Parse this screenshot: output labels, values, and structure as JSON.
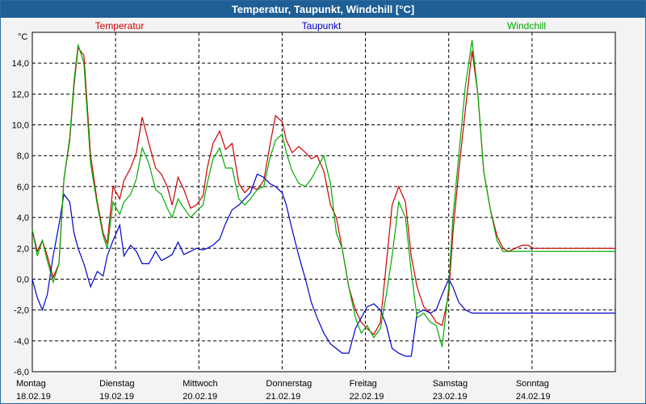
{
  "window": {
    "title": "Temperatur, Taupunkt, Windchill [°C]"
  },
  "colors": {
    "title_bg": "#1f5f96",
    "temperatur": "#cc0000",
    "taupunkt": "#0000cc",
    "windchill": "#00aa00",
    "grid": "#000000"
  },
  "chart_data": {
    "type": "line",
    "title": "Temperatur, Taupunkt, Windchill [°C]",
    "ylabel": "°C",
    "xlabel": "",
    "ylim": [
      -6.0,
      16.0
    ],
    "yticks": [
      "14,0",
      "12,0",
      "10,0",
      "8,0",
      "6,0",
      "4,0",
      "2,0",
      "0,0",
      "-2,0",
      "-4,0",
      "-6,0"
    ],
    "ytick_values": [
      14,
      12,
      10,
      8,
      6,
      4,
      2,
      0,
      -2,
      -4,
      -6
    ],
    "xlim": [
      0,
      7
    ],
    "grid": true,
    "legend_position": "top",
    "days": [
      {
        "name": "Montag",
        "date": "18.02.19"
      },
      {
        "name": "Dienstag",
        "date": "19.02.19"
      },
      {
        "name": "Mittwoch",
        "date": "20.02.19"
      },
      {
        "name": "Donnerstag",
        "date": "21.02.19"
      },
      {
        "name": "Freitag",
        "date": "22.02.19"
      },
      {
        "name": "Samstag",
        "date": "23.02.19"
      },
      {
        "name": "Sonntag",
        "date": "24.02.19"
      }
    ],
    "series": [
      {
        "name": "Temperatur",
        "color": "#cc0000",
        "x": [
          0,
          0.06,
          0.12,
          0.18,
          0.25,
          0.32,
          0.38,
          0.45,
          0.5,
          0.55,
          0.62,
          0.7,
          0.78,
          0.85,
          0.9,
          0.97,
          1.05,
          1.1,
          1.18,
          1.25,
          1.32,
          1.4,
          1.48,
          1.55,
          1.62,
          1.68,
          1.75,
          1.82,
          1.9,
          1.97,
          2.05,
          2.1,
          2.17,
          2.25,
          2.32,
          2.4,
          2.48,
          2.55,
          2.62,
          2.7,
          2.78,
          2.85,
          2.92,
          3.0,
          3.05,
          3.12,
          3.2,
          3.28,
          3.35,
          3.42,
          3.5,
          3.58,
          3.65,
          3.72,
          3.8,
          3.88,
          3.95,
          4.02,
          4.1,
          4.18,
          4.25,
          4.32,
          4.4,
          4.48,
          4.55,
          4.62,
          4.7,
          4.78,
          4.85,
          4.92,
          5.0,
          5.05,
          5.12,
          5.2,
          5.28,
          5.35,
          5.42,
          5.5,
          5.58,
          5.65,
          5.72,
          5.8,
          5.88,
          5.95,
          6.02,
          6.1,
          6.18,
          6.25,
          6.32,
          6.4,
          6.48,
          6.55,
          6.62,
          6.7,
          6.78,
          6.85,
          6.92,
          7.0
        ],
        "y": [
          3.2,
          1.8,
          2.5,
          1.5,
          0.1,
          1.0,
          6.5,
          9.0,
          12.5,
          15.0,
          14.5,
          8.0,
          5.0,
          3.0,
          2.3,
          6.0,
          5.2,
          6.4,
          7.2,
          8.2,
          10.5,
          8.8,
          7.2,
          6.8,
          6.0,
          4.8,
          6.6,
          5.8,
          4.6,
          4.8,
          5.4,
          7.2,
          8.8,
          9.6,
          8.4,
          8.8,
          6.2,
          5.6,
          6.0,
          5.8,
          6.4,
          8.6,
          10.6,
          10.2,
          9.0,
          8.2,
          8.6,
          8.2,
          7.8,
          8.0,
          7.0,
          4.8,
          4.0,
          2.0,
          -0.5,
          -2.0,
          -2.8,
          -3.2,
          -3.6,
          -2.8,
          1.0,
          4.8,
          6.0,
          5.0,
          1.5,
          -0.5,
          -1.8,
          -2.2,
          -2.8,
          -3.0,
          -1.0,
          3.0,
          7.0,
          11.0,
          14.8,
          12.0,
          7.0,
          4.5,
          2.8,
          2.0,
          1.8,
          2.0,
          2.2,
          2.2,
          2.0,
          2.0,
          2.0,
          2.0,
          2.0,
          2.0,
          2.0,
          2.0,
          2.0,
          2.0,
          2.0,
          2.0,
          2.0,
          2.0
        ]
      },
      {
        "name": "Taupunkt",
        "color": "#0000cc",
        "x": [
          0,
          0.06,
          0.12,
          0.18,
          0.25,
          0.32,
          0.38,
          0.45,
          0.5,
          0.55,
          0.62,
          0.7,
          0.78,
          0.85,
          0.9,
          0.97,
          1.05,
          1.1,
          1.18,
          1.25,
          1.32,
          1.4,
          1.48,
          1.55,
          1.62,
          1.68,
          1.75,
          1.82,
          1.9,
          1.97,
          2.05,
          2.1,
          2.17,
          2.25,
          2.32,
          2.4,
          2.48,
          2.55,
          2.62,
          2.7,
          2.78,
          2.85,
          2.92,
          3.0,
          3.05,
          3.12,
          3.2,
          3.28,
          3.35,
          3.42,
          3.5,
          3.58,
          3.65,
          3.72,
          3.8,
          3.88,
          3.95,
          4.02,
          4.1,
          4.18,
          4.25,
          4.32,
          4.4,
          4.48,
          4.55,
          4.62,
          4.7,
          4.78,
          4.85,
          4.92,
          5.0,
          5.05,
          5.12,
          5.2,
          5.28,
          5.35,
          5.42,
          5.5,
          5.58,
          5.65,
          5.72,
          5.8,
          5.88,
          5.95,
          6.02,
          6.1,
          6.18,
          6.25,
          6.32,
          6.4,
          6.48,
          6.55,
          6.62,
          6.7,
          6.78,
          6.85,
          6.92,
          7.0
        ],
        "y": [
          0.0,
          -1.2,
          -2.0,
          -1.0,
          1.5,
          3.5,
          5.5,
          5.0,
          3.0,
          2.0,
          1.0,
          -0.5,
          0.5,
          0.2,
          1.5,
          2.5,
          3.5,
          1.5,
          2.2,
          1.8,
          1.0,
          1.0,
          1.8,
          1.2,
          1.4,
          1.6,
          2.4,
          1.6,
          1.8,
          2.0,
          1.9,
          2.0,
          2.2,
          2.6,
          3.6,
          4.5,
          4.8,
          5.2,
          5.6,
          6.8,
          6.6,
          6.2,
          6.0,
          5.6,
          4.8,
          3.2,
          1.5,
          0.0,
          -1.5,
          -2.5,
          -3.5,
          -4.2,
          -4.5,
          -4.8,
          -4.8,
          -3.2,
          -2.5,
          -1.8,
          -1.6,
          -2.0,
          -3.0,
          -4.5,
          -4.8,
          -5.0,
          -5.0,
          -2.2,
          -2.0,
          -2.2,
          -2.0,
          -1.0,
          0.0,
          -0.5,
          -1.5,
          -2.0,
          -2.2,
          -2.2,
          -2.2,
          -2.2,
          -2.2,
          -2.2,
          -2.2,
          -2.2,
          -2.2,
          -2.2,
          -2.2,
          -2.2,
          -2.2,
          -2.2,
          -2.2,
          -2.2,
          -2.2,
          -2.2,
          -2.2,
          -2.2,
          -2.2,
          -2.2,
          -2.2,
          -2.2
        ]
      },
      {
        "name": "Windchill",
        "color": "#00aa00",
        "x": [
          0,
          0.06,
          0.12,
          0.18,
          0.25,
          0.32,
          0.38,
          0.45,
          0.5,
          0.55,
          0.62,
          0.7,
          0.78,
          0.85,
          0.9,
          0.97,
          1.05,
          1.1,
          1.18,
          1.25,
          1.32,
          1.4,
          1.48,
          1.55,
          1.62,
          1.68,
          1.75,
          1.82,
          1.9,
          1.97,
          2.05,
          2.1,
          2.17,
          2.25,
          2.32,
          2.4,
          2.48,
          2.55,
          2.62,
          2.7,
          2.78,
          2.85,
          2.92,
          3.0,
          3.05,
          3.12,
          3.2,
          3.28,
          3.35,
          3.42,
          3.5,
          3.58,
          3.65,
          3.72,
          3.8,
          3.88,
          3.95,
          4.02,
          4.1,
          4.18,
          4.25,
          4.32,
          4.4,
          4.48,
          4.55,
          4.62,
          4.7,
          4.78,
          4.85,
          4.92,
          5.0,
          5.05,
          5.12,
          5.2,
          5.28,
          5.35,
          5.42,
          5.5,
          5.58,
          5.65,
          5.72,
          5.8,
          5.88,
          5.95,
          6.02,
          6.1,
          6.18,
          6.25,
          6.32,
          6.4,
          6.48,
          6.55,
          6.62,
          6.7,
          6.78,
          6.85,
          6.92,
          7.0
        ],
        "y": [
          3.2,
          1.5,
          2.5,
          1.2,
          -0.2,
          1.0,
          6.5,
          9.2,
          12.8,
          15.2,
          14.0,
          7.5,
          4.8,
          2.8,
          2.0,
          5.0,
          4.2,
          5.0,
          5.5,
          6.5,
          8.5,
          7.5,
          5.8,
          5.5,
          4.6,
          4.0,
          5.2,
          4.6,
          4.0,
          4.4,
          4.8,
          6.2,
          7.8,
          8.5,
          7.2,
          7.2,
          5.2,
          4.8,
          5.2,
          5.8,
          6.0,
          7.8,
          9.0,
          9.4,
          8.2,
          7.0,
          6.2,
          6.0,
          6.5,
          7.2,
          8.0,
          6.2,
          3.0,
          2.0,
          -0.5,
          -2.5,
          -3.5,
          -3.0,
          -3.8,
          -3.2,
          -1.0,
          1.5,
          5.0,
          4.0,
          0.5,
          -2.5,
          -2.2,
          -2.8,
          -3.0,
          -4.4,
          -0.5,
          4.0,
          8.0,
          12.5,
          15.5,
          12.0,
          7.0,
          4.5,
          2.5,
          1.8,
          1.8,
          1.8,
          1.8,
          1.8,
          1.8,
          1.8,
          1.8,
          1.8,
          1.8,
          1.8,
          1.8,
          1.8,
          1.8,
          1.8,
          1.8,
          1.8,
          1.8,
          1.8
        ]
      }
    ]
  }
}
